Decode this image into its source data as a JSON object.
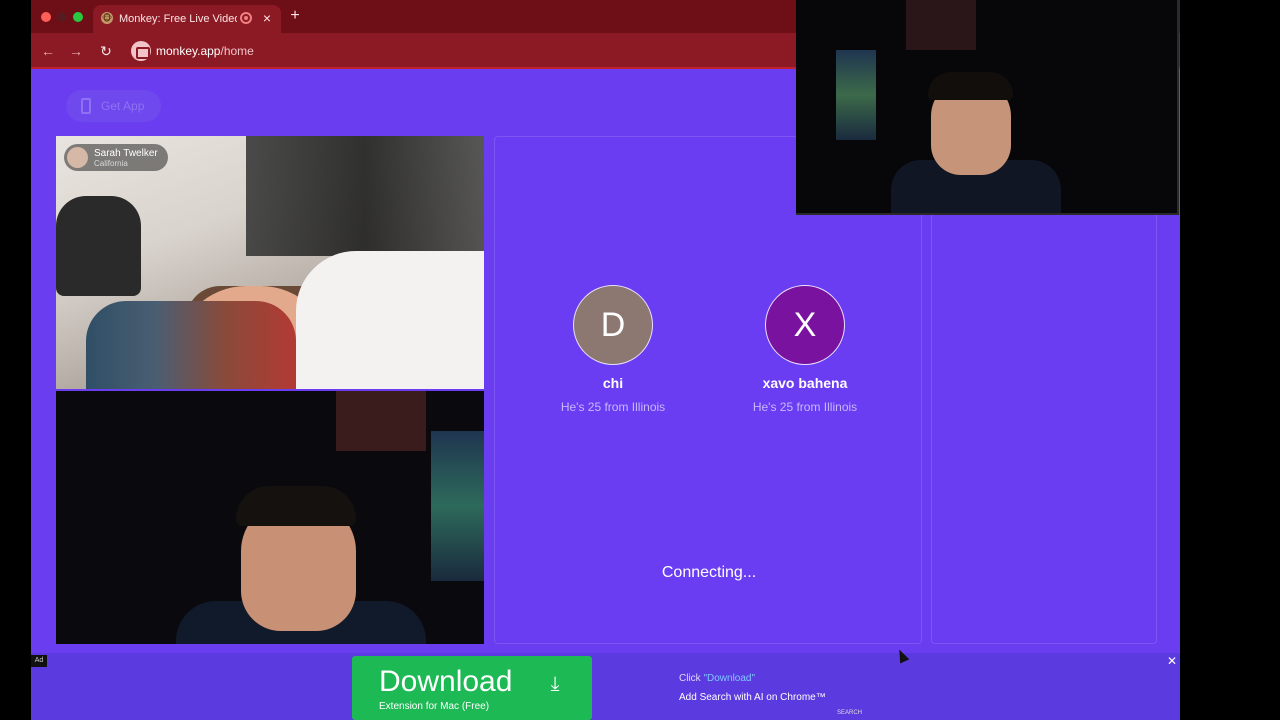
{
  "browser": {
    "tab_title": "Monkey: Free Live Video Chat",
    "tab_favicon": "🐵",
    "tab_close": "×",
    "new_tab": "+",
    "back": "←",
    "forward": "→",
    "reload": "↻",
    "url_domain": "monkey.app",
    "url_path": "/home"
  },
  "page": {
    "get_app_label": "Get App",
    "video_user": {
      "name": "Sarah Twelker",
      "location": "California"
    },
    "matches": [
      {
        "initial": "D",
        "name": "chi",
        "subtitle": "He's 25 from Illinois",
        "avatar_color": "#8c7870"
      },
      {
        "initial": "X",
        "name": "xavo bahena",
        "subtitle": "He's 25 from Illinois",
        "avatar_color": "#7a12a0"
      }
    ],
    "status": "Connecting..."
  },
  "ad": {
    "tag": "Ad",
    "close": "✕",
    "button_label": "Download",
    "button_icon": "download-icon",
    "button_sub": "Extension for Mac (Free)",
    "line1_prefix": "Click ",
    "line1_accent": "\"Download\"",
    "line2": "Add Search with AI on Chrome™",
    "small": "SEARCH"
  },
  "colors": {
    "page_bg": "#6a3ef0",
    "tab_bar": "#6e0f17",
    "toolbar": "#8c1a24",
    "download_green": "#1db954"
  }
}
